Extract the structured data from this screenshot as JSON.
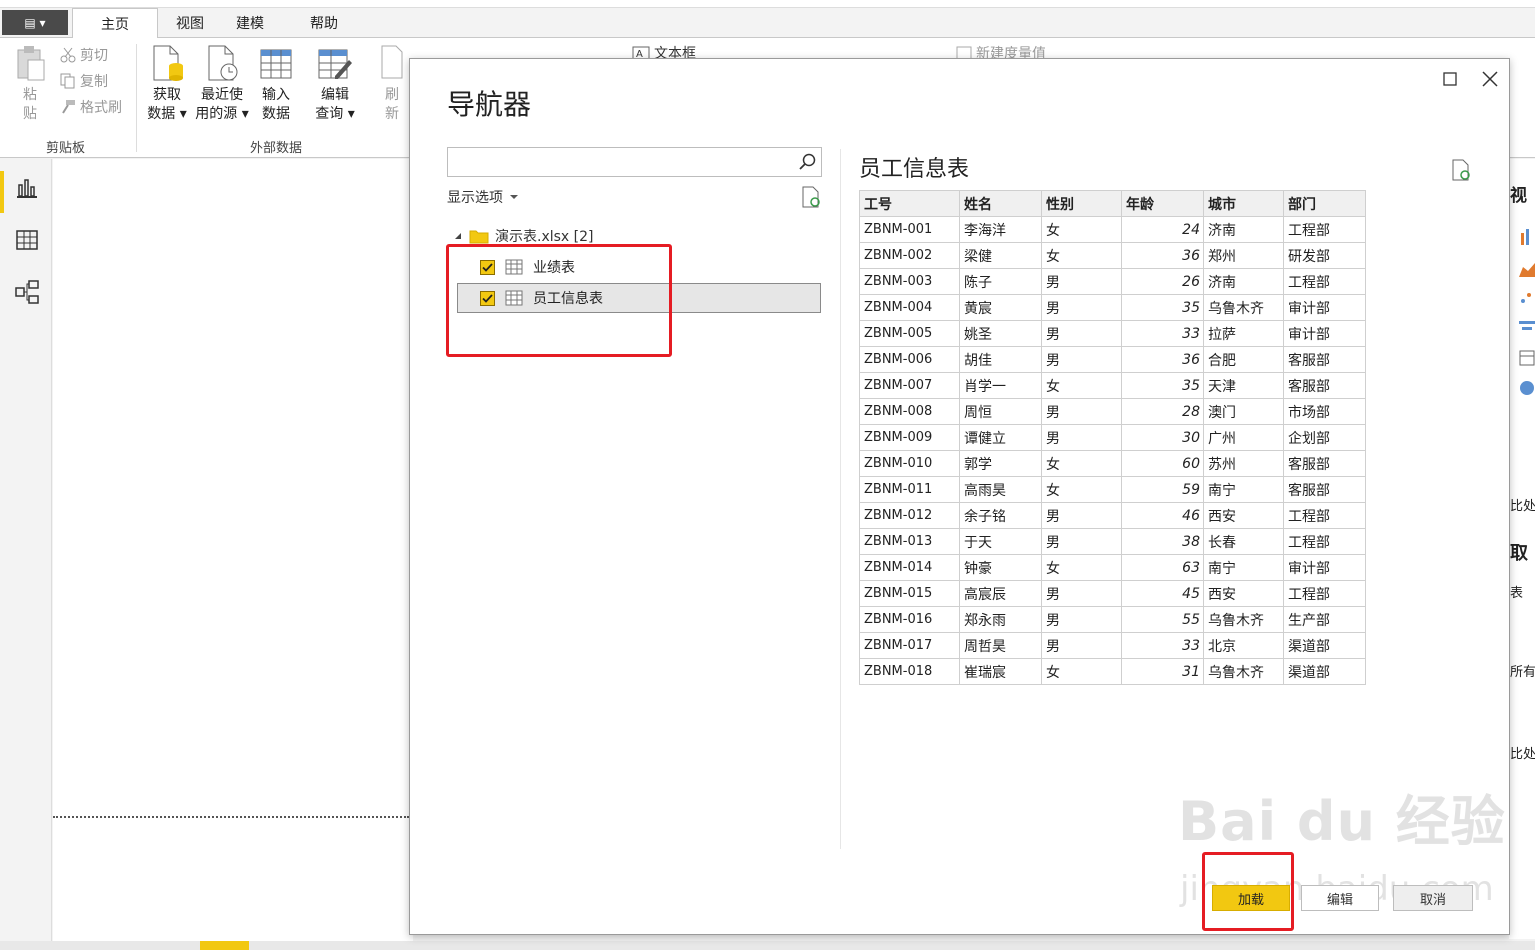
{
  "ribbon": {
    "file_menu_label": "▤ ▾",
    "tabs": [
      "主页",
      "视图",
      "建模",
      "帮助"
    ],
    "clipboard": {
      "paste": [
        "粘",
        "贴"
      ],
      "cut": "剪切",
      "copy": "复制",
      "format_painter": "格式刷",
      "group_label": "剪贴板"
    },
    "external_data": {
      "get_data": [
        "获取",
        "数据 ▾"
      ],
      "recent_sources": [
        "最近使",
        "用的源 ▾"
      ],
      "enter_data": [
        "输入",
        "数据"
      ],
      "edit_queries": [
        "编辑",
        "查询 ▾"
      ],
      "refresh": [
        "刷",
        "新"
      ],
      "group_label": "外部数据"
    },
    "insert": {
      "text_box": "文本框"
    },
    "calc": {
      "new_measure": "新建度量值"
    }
  },
  "right_pane": {
    "texts": [
      "视",
      "比处",
      "取",
      "表",
      "所有",
      "比处"
    ]
  },
  "navigator": {
    "title": "导航器",
    "search_placeholder": "",
    "display_options": "显示选项",
    "tree": {
      "file": "演示表.xlsx [2]",
      "items": [
        {
          "label": "业绩表",
          "checked": true,
          "selected": false
        },
        {
          "label": "员工信息表",
          "checked": true,
          "selected": true
        }
      ]
    },
    "preview": {
      "title": "员工信息表",
      "columns": [
        "工号",
        "姓名",
        "性别",
        "年龄",
        "城市",
        "部门"
      ],
      "rows": [
        [
          "ZBNM-001",
          "李海洋",
          "女",
          "24",
          "济南",
          "工程部"
        ],
        [
          "ZBNM-002",
          "梁健",
          "女",
          "36",
          "郑州",
          "研发部"
        ],
        [
          "ZBNM-003",
          "陈子",
          "男",
          "26",
          "济南",
          "工程部"
        ],
        [
          "ZBNM-004",
          "黄宸",
          "男",
          "35",
          "乌鲁木齐",
          "审计部"
        ],
        [
          "ZBNM-005",
          "姚圣",
          "男",
          "33",
          "拉萨",
          "审计部"
        ],
        [
          "ZBNM-006",
          "胡佳",
          "男",
          "36",
          "合肥",
          "客服部"
        ],
        [
          "ZBNM-007",
          "肖学一",
          "女",
          "35",
          "天津",
          "客服部"
        ],
        [
          "ZBNM-008",
          "周恒",
          "男",
          "28",
          "澳门",
          "市场部"
        ],
        [
          "ZBNM-009",
          "谭健立",
          "男",
          "30",
          "广州",
          "企划部"
        ],
        [
          "ZBNM-010",
          "郭学",
          "女",
          "60",
          "苏州",
          "客服部"
        ],
        [
          "ZBNM-011",
          "高雨昊",
          "女",
          "59",
          "南宁",
          "客服部"
        ],
        [
          "ZBNM-012",
          "余子铭",
          "男",
          "46",
          "西安",
          "工程部"
        ],
        [
          "ZBNM-013",
          "于天",
          "男",
          "38",
          "长春",
          "工程部"
        ],
        [
          "ZBNM-014",
          "钟豪",
          "女",
          "63",
          "南宁",
          "审计部"
        ],
        [
          "ZBNM-015",
          "高宸辰",
          "男",
          "45",
          "西安",
          "工程部"
        ],
        [
          "ZBNM-016",
          "郑永雨",
          "男",
          "55",
          "乌鲁木齐",
          "生产部"
        ],
        [
          "ZBNM-017",
          "周哲昊",
          "男",
          "33",
          "北京",
          "渠道部"
        ],
        [
          "ZBNM-018",
          "崔瑞宸",
          "女",
          "31",
          "乌鲁木齐",
          "渠道部"
        ]
      ]
    },
    "buttons": {
      "load": "加载",
      "edit": "编辑",
      "cancel": "取消"
    }
  },
  "watermark": {
    "line1": "Bai du 经验",
    "line2": "jingyan.baidu.com"
  },
  "colors": {
    "accent": "#f2c811",
    "highlight": "#e51c23"
  }
}
